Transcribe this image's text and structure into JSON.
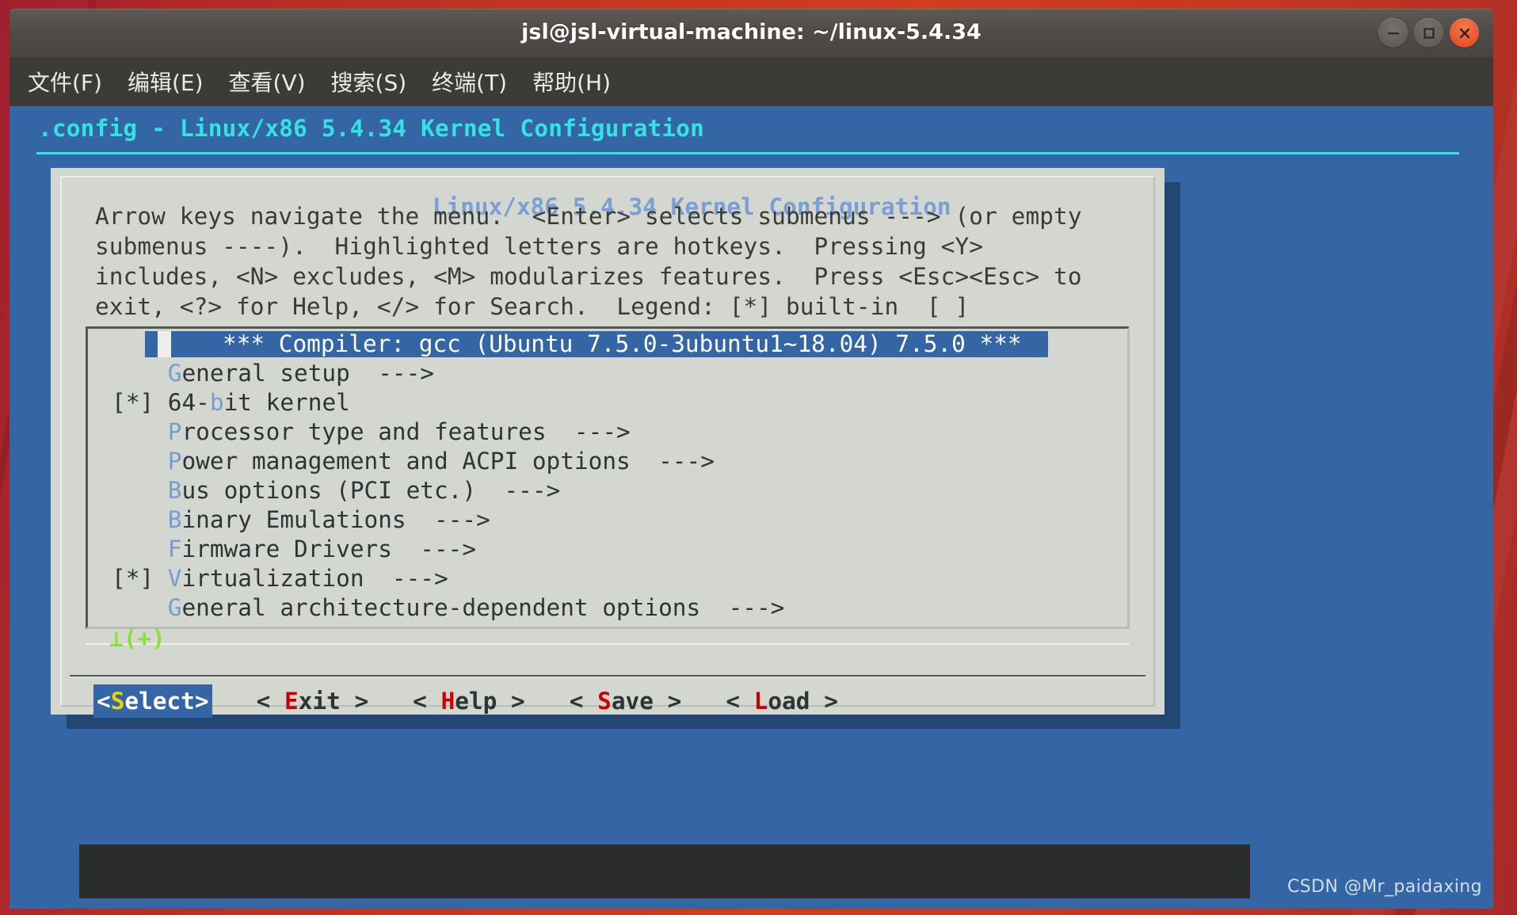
{
  "window": {
    "title": "jsl@jsl-virtual-machine: ~/linux-5.4.34",
    "controls": {
      "minimize": "minimize-button",
      "maximize": "maximize-button",
      "close": "close-button"
    }
  },
  "menubar": {
    "items": [
      {
        "label": "文件(F)"
      },
      {
        "label": "编辑(E)"
      },
      {
        "label": "查看(V)"
      },
      {
        "label": "搜索(S)"
      },
      {
        "label": "终端(T)"
      },
      {
        "label": "帮助(H)"
      }
    ]
  },
  "terminal": {
    "header": ".config - Linux/x86 5.4.34 Kernel Configuration",
    "dialog_title": "Linux/x86 5.4.34 Kernel Configuration",
    "help_lines": [
      "Arrow keys navigate the menu.  <Enter> selects submenus ---> (or empty",
      "submenus ----).  Highlighted letters are hotkeys.  Pressing <Y>",
      "includes, <N> excludes, <M> modularizes features.  Press <Esc><Esc> to",
      "exit, <?> for Help, </> for Search.  Legend: [*] built-in  [ ]"
    ],
    "scroll_indicator": "⊥(+)",
    "menu_items": [
      {
        "selected": true,
        "prefix": "",
        "hotkey": "",
        "text": "*** Compiler: gcc (Ubuntu 7.5.0-3ubuntu1~18.04) 7.5.0 ***",
        "arrow": ""
      },
      {
        "selected": false,
        "prefix": "    ",
        "hotkey": "G",
        "text": "eneral setup",
        "arrow": "  --->"
      },
      {
        "selected": false,
        "prefix": "[*] ",
        "hotkey": "",
        "pre_hotkey": "64-",
        "hotkey2": "b",
        "text": "it kernel",
        "arrow": ""
      },
      {
        "selected": false,
        "prefix": "    ",
        "hotkey": "P",
        "text": "rocessor type and features",
        "arrow": "  --->"
      },
      {
        "selected": false,
        "prefix": "    ",
        "hotkey": "P",
        "text": "ower management and ACPI options",
        "arrow": "  --->"
      },
      {
        "selected": false,
        "prefix": "    ",
        "hotkey": "B",
        "text": "us options (PCI etc.)",
        "arrow": "  --->"
      },
      {
        "selected": false,
        "prefix": "    ",
        "hotkey": "B",
        "text": "inary Emulations",
        "arrow": "  --->"
      },
      {
        "selected": false,
        "prefix": "    ",
        "hotkey": "F",
        "text": "irmware Drivers",
        "arrow": "  --->"
      },
      {
        "selected": false,
        "prefix": "[*] ",
        "hotkey": "V",
        "text": "irtualization",
        "arrow": "  --->"
      },
      {
        "selected": false,
        "prefix": "    ",
        "hotkey": "G",
        "text": "eneral architecture-dependent options",
        "arrow": "  --->"
      }
    ],
    "buttons": [
      {
        "active": true,
        "open": "<",
        "hotkey": "S",
        "rest": "elect",
        "close": ">"
      },
      {
        "active": false,
        "open": "< ",
        "hotkey": "E",
        "rest": "xit",
        "close": " >"
      },
      {
        "active": false,
        "open": "< ",
        "hotkey": "H",
        "rest": "elp",
        "close": " >"
      },
      {
        "active": false,
        "open": "< ",
        "hotkey": "S",
        "rest": "ave",
        "close": " >"
      },
      {
        "active": false,
        "open": "< ",
        "hotkey": "L",
        "rest": "oad",
        "close": " >"
      }
    ]
  },
  "watermark": "CSDN @Mr_paidaxing",
  "colors": {
    "terminal_blue": "#3465a4",
    "dialog_bg": "#d3d7cf",
    "cyan": "#34e2e2",
    "hotkey_blue": "#729fcf",
    "hotkey_red": "#cc0000",
    "hotkey_yellow": "#edd400",
    "green": "#8ae234",
    "close_orange": "#e8562c"
  }
}
